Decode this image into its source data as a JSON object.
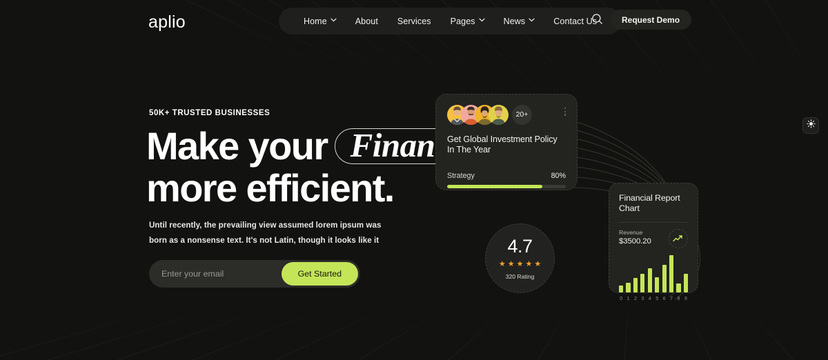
{
  "brand": {
    "logo": "aplio"
  },
  "nav": {
    "items": [
      {
        "label": "Home",
        "has_caret": true
      },
      {
        "label": "About",
        "has_caret": false
      },
      {
        "label": "Services",
        "has_caret": false
      },
      {
        "label": "Pages",
        "has_caret": true
      },
      {
        "label": "News",
        "has_caret": true
      },
      {
        "label": "Contact Us",
        "has_caret": false
      }
    ],
    "search_icon": "search-icon",
    "demo_button": "Request Demo"
  },
  "hero": {
    "eyebrow": "50K+ TRUSTED BUSINESSES",
    "headline_part1": "Make your",
    "headline_highlight": "Finance",
    "headline_part2": "more efficient.",
    "subcopy": "Until recently, the prevailing view assumed lorem ipsum was born as a nonsense text. It's not Latin, though it looks like it",
    "email_placeholder": "Enter your email",
    "email_value": "",
    "cta_label": "Get Started"
  },
  "invest_card": {
    "avatar_badge": "20+",
    "avatar_colors": [
      "#f5c142",
      "#f0a8a0",
      "#f0b32c",
      "#e2d14a"
    ],
    "title": "Get Global Investment Policy In The Year",
    "metric_label": "Strategy",
    "metric_value": "80%",
    "progress_percent": 80
  },
  "rating_card": {
    "score": "4.7",
    "stars": 5,
    "count_label": "320 Rating"
  },
  "report_card": {
    "title": "Financial Report Chart",
    "revenue_label": "Revenue",
    "revenue_value": "$3500.20",
    "trend_icon": "trend-up-icon"
  },
  "theme_toggle": {
    "icon": "sun-icon"
  },
  "colors": {
    "background": "#121210",
    "surface": "#232320",
    "accent": "#c4e558",
    "star": "#f0a22e",
    "text": "#ffffff"
  },
  "chart_data": {
    "type": "bar",
    "title": "Financial Report Chart",
    "categories": [
      "0",
      "1",
      "2",
      "3",
      "4",
      "5",
      "6",
      "7",
      "8",
      "9"
    ],
    "values": [
      12,
      18,
      26,
      34,
      44,
      28,
      50,
      68,
      16,
      34
    ],
    "xlabel": "",
    "ylabel": "",
    "ylim": [
      0,
      70
    ],
    "grid": false,
    "legend": false,
    "color": "#c4e558"
  }
}
